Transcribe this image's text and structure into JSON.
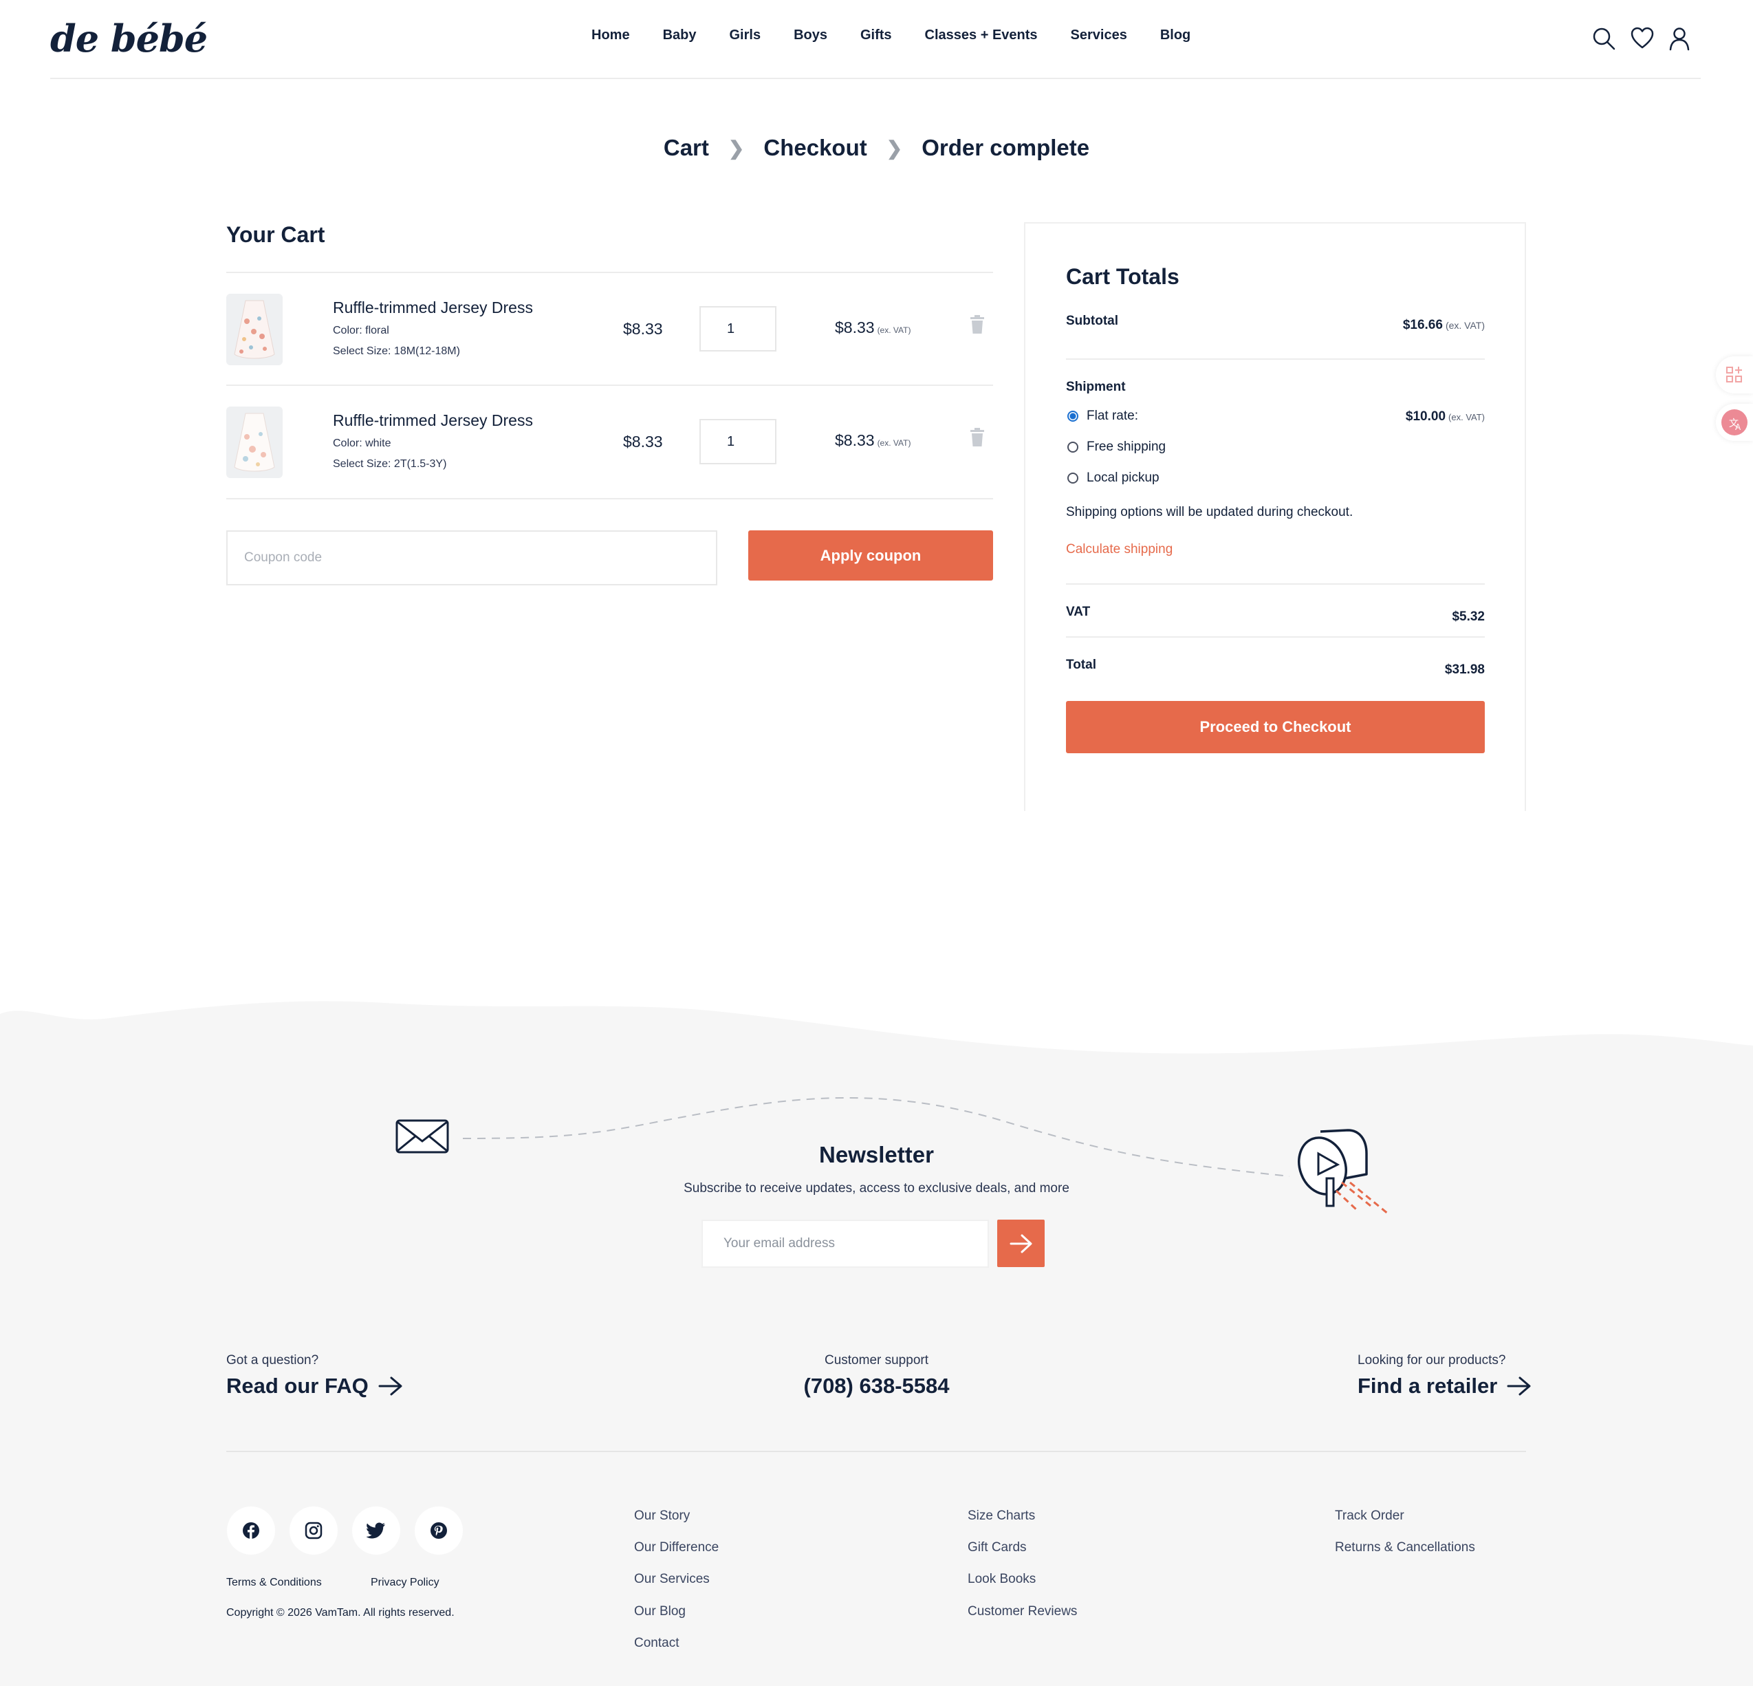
{
  "header": {
    "logo": "de bébé",
    "nav": [
      "Home",
      "Baby",
      "Girls",
      "Boys",
      "Gifts",
      "Classes + Events",
      "Services",
      "Blog"
    ]
  },
  "steps": [
    "Cart",
    "Checkout",
    "Order complete"
  ],
  "cart": {
    "title": "Your Cart",
    "items": [
      {
        "name": "Ruffle-trimmed Jersey Dress",
        "color": "Color: floral",
        "size": "Select Size: 18M(12-18M)",
        "price": "$8.33",
        "qty": "1",
        "subtotal": "$8.33",
        "vat_note": "(ex. VAT)"
      },
      {
        "name": "Ruffle-trimmed Jersey Dress",
        "color": "Color: white",
        "size": "Select Size: 2T(1.5-3Y)",
        "price": "$8.33",
        "qty": "1",
        "subtotal": "$8.33",
        "vat_note": "(ex. VAT)"
      }
    ],
    "coupon_placeholder": "Coupon code",
    "apply_label": "Apply coupon"
  },
  "totals": {
    "title": "Cart Totals",
    "subtotal_label": "Subtotal",
    "subtotal_value": "$16.66",
    "subtotal_note": "(ex. VAT)",
    "shipment_label": "Shipment",
    "options": [
      {
        "label": "Flat rate:",
        "value": "$10.00",
        "note": "(ex. VAT)",
        "selected": true
      },
      {
        "label": "Free shipping",
        "selected": false
      },
      {
        "label": "Local pickup",
        "selected": false
      }
    ],
    "shipping_note": "Shipping options will be updated during checkout.",
    "calculate_label": "Calculate shipping",
    "vat_label": "VAT",
    "vat_value": "$5.32",
    "total_label": "Total",
    "total_value": "$31.98",
    "proceed_label": "Proceed to Checkout"
  },
  "footer": {
    "newsletter_title": "Newsletter",
    "newsletter_sub": "Subscribe to receive updates, access to exclusive deals, and more",
    "email_placeholder": "Your email address",
    "faq_small": "Got a question?",
    "faq_link": "Read our FAQ",
    "support_small": "Customer support",
    "support_phone": "(708) 638-5584",
    "retailer_small": "Looking for our products?",
    "retailer_link": "Find a retailer",
    "col1": [
      "Our Story",
      "Our Difference",
      "Our Services",
      "Our Blog",
      "Contact"
    ],
    "col2": [
      "Size Charts",
      "Gift Cards",
      "Look Books",
      "Customer Reviews"
    ],
    "col3": [
      "Track Order",
      "Returns & Cancellations"
    ],
    "terms": "Terms & Conditions",
    "privacy": "Privacy Policy",
    "copyright": "Copyright © 2026  VamTam. All rights reserved.",
    "socials": [
      "facebook-icon",
      "instagram-icon",
      "twitter-icon",
      "pinterest-icon"
    ]
  },
  "colors": {
    "accent": "#e66a4b",
    "text": "#13213a",
    "footer_bg": "#f6f6f6"
  }
}
